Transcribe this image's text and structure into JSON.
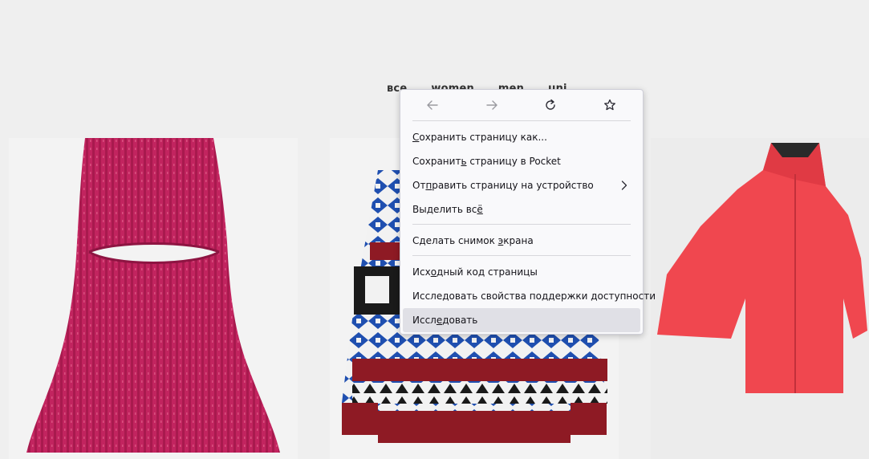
{
  "filters": [
    {
      "id": "all",
      "label": "все"
    },
    {
      "id": "women",
      "label": "women"
    },
    {
      "id": "men",
      "label": "men"
    },
    {
      "id": "uni",
      "label": "uni"
    }
  ],
  "products": [
    {
      "name": "balaclava",
      "color": "#c2245f"
    },
    {
      "name": "sweater",
      "color": "#1f4fb0"
    },
    {
      "name": "coat",
      "color": "#f0474f"
    }
  ],
  "context_menu": {
    "nav": [
      {
        "icon": "back-arrow-icon",
        "enabled": false
      },
      {
        "icon": "forward-arrow-icon",
        "enabled": false
      },
      {
        "icon": "reload-icon",
        "enabled": true
      },
      {
        "icon": "bookmark-star-icon",
        "enabled": true
      }
    ],
    "items": {
      "save_page": {
        "pre": "",
        "key": "С",
        "post": "охранить страницу как..."
      },
      "save_pocket": {
        "pre": "Сохранит",
        "key": "ь",
        "post": " страницу в Pocket"
      },
      "send_device": {
        "pre": "От",
        "key": "п",
        "post": "равить страницу на устройство"
      },
      "select_all": {
        "pre": "Выделить вс",
        "key": "ё",
        "post": ""
      },
      "screenshot": {
        "pre": "Сделать снимок ",
        "key": "э",
        "post": "крана"
      },
      "view_source": {
        "pre": "Исх",
        "key": "о",
        "post": "дный код страницы"
      },
      "accessibility": {
        "pre": "Исследовать свойства поддержки доступности",
        "key": "",
        "post": ""
      },
      "inspect": {
        "pre": "Иссл",
        "key": "е",
        "post": "довать"
      }
    }
  }
}
